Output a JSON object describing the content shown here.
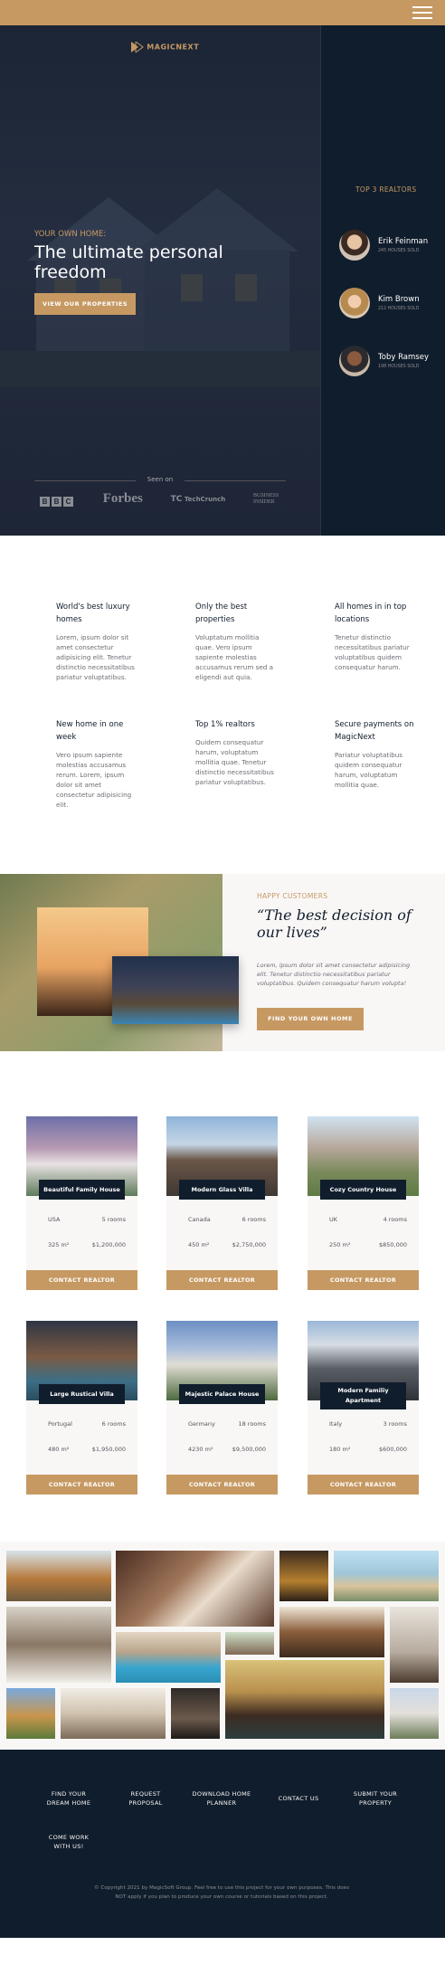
{
  "nav": {
    "menu_icon": "hamburger-icon"
  },
  "hero": {
    "logo_text": "MAGICNEXT",
    "subtitle": "YOUR OWN HOME:",
    "title": "The ultimate personal freedom",
    "cta": "VIEW OUR PROPERTIES",
    "seen_on": "Seen on",
    "press": [
      "BBC",
      "Forbes",
      "TechCrunch",
      "BUSINESS INSIDER"
    ]
  },
  "realtors": {
    "title": "TOP 3 REALTORS",
    "items": [
      {
        "name": "Erik Feinman",
        "sold": "245 HOUSES SOLD"
      },
      {
        "name": "Kim Brown",
        "sold": "212 HOUSES SOLD"
      },
      {
        "name": "Toby Ramsey",
        "sold": "198 HOUSES SOLD"
      }
    ]
  },
  "features": [
    {
      "title": "World's best luxury homes",
      "text": "Lorem, ipsum dolor sit amet consectetur adipisicing elit. Tenetur distinctio necessitatibus pariatur voluptatibus."
    },
    {
      "title": "Only the best properties",
      "text": "Voluptatum mollitia quae. Vero ipsum sapiente molestias accusamus rerum sed a eligendi aut quia."
    },
    {
      "title": "All homes in in top locations",
      "text": "Tenetur distinctio necessitatibus pariatur voluptatibus quidem consequatur harum."
    },
    {
      "title": "New home in one week",
      "text": "Vero ipsum sapiente molestias accusamus rerum. Lorem, ipsum dolor sit amet consectetur adipisicing elit."
    },
    {
      "title": "Top 1% realtors",
      "text": "Quidem consequatur harum, voluptatum mollitia quae. Tenetur distinctio necessitatibus pariatur voluptatibus."
    },
    {
      "title": "Secure payments on MagicNext",
      "text": "Pariatur voluptatibus quidem consequatur harum, voluptatum mollitia quae."
    }
  ],
  "story": {
    "subtitle": "HAPPY CUSTOMERS",
    "title": "“The best decision of our lives”",
    "text": "Lorem, ipsum dolor sit amet consectetur adipisicing elit. Tenetur distinctio necessitatibus pariatur voluptatibus. Quidem consequatur harum volupta!",
    "cta": "FIND YOUR OWN HOME"
  },
  "homes": [
    {
      "name": "Beautiful Family House",
      "country": "USA",
      "rooms": "5 rooms",
      "area": "325 m²",
      "price": "$1,200,000",
      "cta": "CONTACT REALTOR"
    },
    {
      "name": "Modern Glass Villa",
      "country": "Canada",
      "rooms": "6 rooms",
      "area": "450 m²",
      "price": "$2,750,000",
      "cta": "CONTACT REALTOR"
    },
    {
      "name": "Cozy Country House",
      "country": "UK",
      "rooms": "4 rooms",
      "area": "250 m²",
      "price": "$850,000",
      "cta": "CONTACT REALTOR"
    },
    {
      "name": "Large Rustical Villa",
      "country": "Portugal",
      "rooms": "6 rooms",
      "area": "480 m²",
      "price": "$1,950,000",
      "cta": "CONTACT REALTOR"
    },
    {
      "name": "Majestic Palace House",
      "country": "Germany",
      "rooms": "18 rooms",
      "area": "4230 m²",
      "price": "$9,500,000",
      "cta": "CONTACT REALTOR"
    },
    {
      "name": "Modern Familiy Apartment",
      "country": "Italy",
      "rooms": "3 rooms",
      "area": "180 m²",
      "price": "$600,000",
      "cta": "CONTACT REALTOR"
    }
  ],
  "footer": {
    "links": [
      "FIND YOUR DREAM HOME",
      "REQUEST PROPOSAL",
      "DOWNLOAD HOME PLANNER",
      "CONTACT US",
      "SUBMIT YOUR PROPERTY",
      "COME WORK WITH US!"
    ],
    "copyright": "© Copyright 2021 by MagicSoft Group. Feel free to use this project for your own purposes. This does NOT apply if you plan to produce your own course or tutorials based on this project."
  },
  "colors": {
    "primary": "#c69963",
    "dark": "#101d2c",
    "light": "#f9f7f6"
  }
}
